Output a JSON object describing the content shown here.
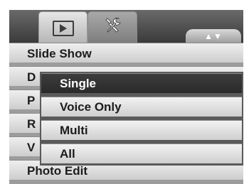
{
  "tabs": {
    "playback": {
      "icon": "playback-icon"
    },
    "setup": {
      "icon": "wrench-icon"
    }
  },
  "nav": {
    "label": "▲▼",
    "icon": "up-down-arrows-icon"
  },
  "menu": {
    "items": [
      {
        "label": "Slide Show"
      },
      {
        "label": "D"
      },
      {
        "label": "P"
      },
      {
        "label": "R"
      },
      {
        "label": "V"
      },
      {
        "label": "Photo Edit"
      }
    ]
  },
  "submenu": {
    "selected_index": 0,
    "items": [
      {
        "label": "Single"
      },
      {
        "label": "Voice Only"
      },
      {
        "label": "Multi"
      },
      {
        "label": "All"
      }
    ]
  },
  "colors": {
    "selected_bg": "#333333",
    "selected_text": "#ffffff",
    "item_text": "#1c1c1c"
  }
}
